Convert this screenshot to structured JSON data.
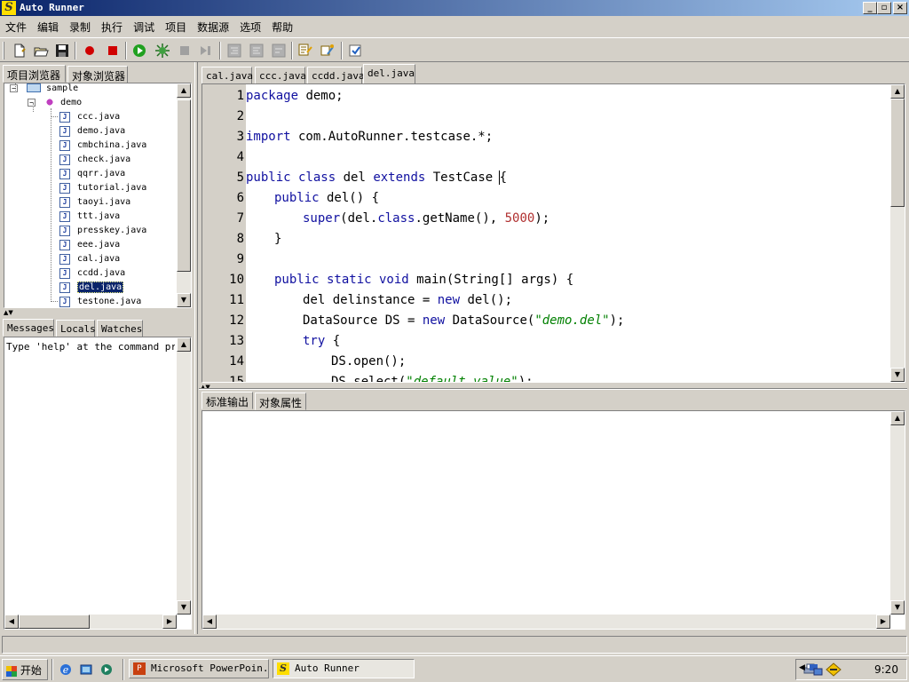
{
  "window": {
    "title": "Auto Runner",
    "icon_glyph": "S"
  },
  "menu": [
    "文件",
    "编辑",
    "录制",
    "执行",
    "调试",
    "项目",
    "数据源",
    "选项",
    "帮助"
  ],
  "left_tabs": [
    "项目浏览器",
    "对象浏览器"
  ],
  "tree": {
    "root": "sample",
    "package": "demo",
    "files": [
      "ccc.java",
      "demo.java",
      "cmbchina.java",
      "check.java",
      "qqrr.java",
      "tutorial.java",
      "taoyi.java",
      "ttt.java",
      "presskey.java",
      "eee.java",
      "cal.java",
      "ccdd.java",
      "del.java",
      "testone.java"
    ],
    "selected": "del.java"
  },
  "bottom_left_tabs": [
    "Messages",
    "Locals",
    "Watches"
  ],
  "messages_text": "Type 'help' at the command prompt",
  "editor_tabs": [
    "cal.java",
    "ccc.java",
    "ccdd.java",
    "del.java"
  ],
  "active_editor_tab": "del.java",
  "line_numbers": [
    "1",
    "2",
    "3",
    "4",
    "5",
    "6",
    "7",
    "8",
    "9",
    "10",
    "11",
    "12",
    "13",
    "14",
    "15"
  ],
  "code": {
    "l1_kw": "package",
    "l1_rest": " demo;",
    "l3_kw": "import",
    "l3_rest": " com.AutoRunner.testcase.*;",
    "l5_kw1": "public class",
    "l5_mid": " del ",
    "l5_kw2": "extends",
    "l5_rest": " TestCase ",
    "l6_kw": "public",
    "l6_rest": " del() {",
    "l7_kw1": "super",
    "l7_a": "(del.",
    "l7_kw2": "class",
    "l7_b": ".getName(), ",
    "l7_num": "5000",
    "l7_c": ");",
    "l8": "}",
    "l10_kw": "public static void",
    "l10_rest": " main(String[] args) {",
    "l11_a": "del delinstance = ",
    "l11_kw": "new",
    "l11_b": " del();",
    "l12_a": "DataSource DS = ",
    "l12_kw": "new",
    "l12_b": " DataSource(",
    "l12_str": "\"demo.del\"",
    "l12_c": ");",
    "l13_kw": "try",
    "l13_rest": " {",
    "l14": "DS.open();",
    "l15_a": "DS.select(",
    "l15_str": "\"default value\"",
    "l15_b": ");"
  },
  "output_tabs": [
    "标准输出",
    "对象属性"
  ],
  "taskbar": {
    "start": "开始",
    "tasks": [
      "Microsoft PowerPoin...",
      "Auto Runner"
    ],
    "clock": "9:20"
  }
}
